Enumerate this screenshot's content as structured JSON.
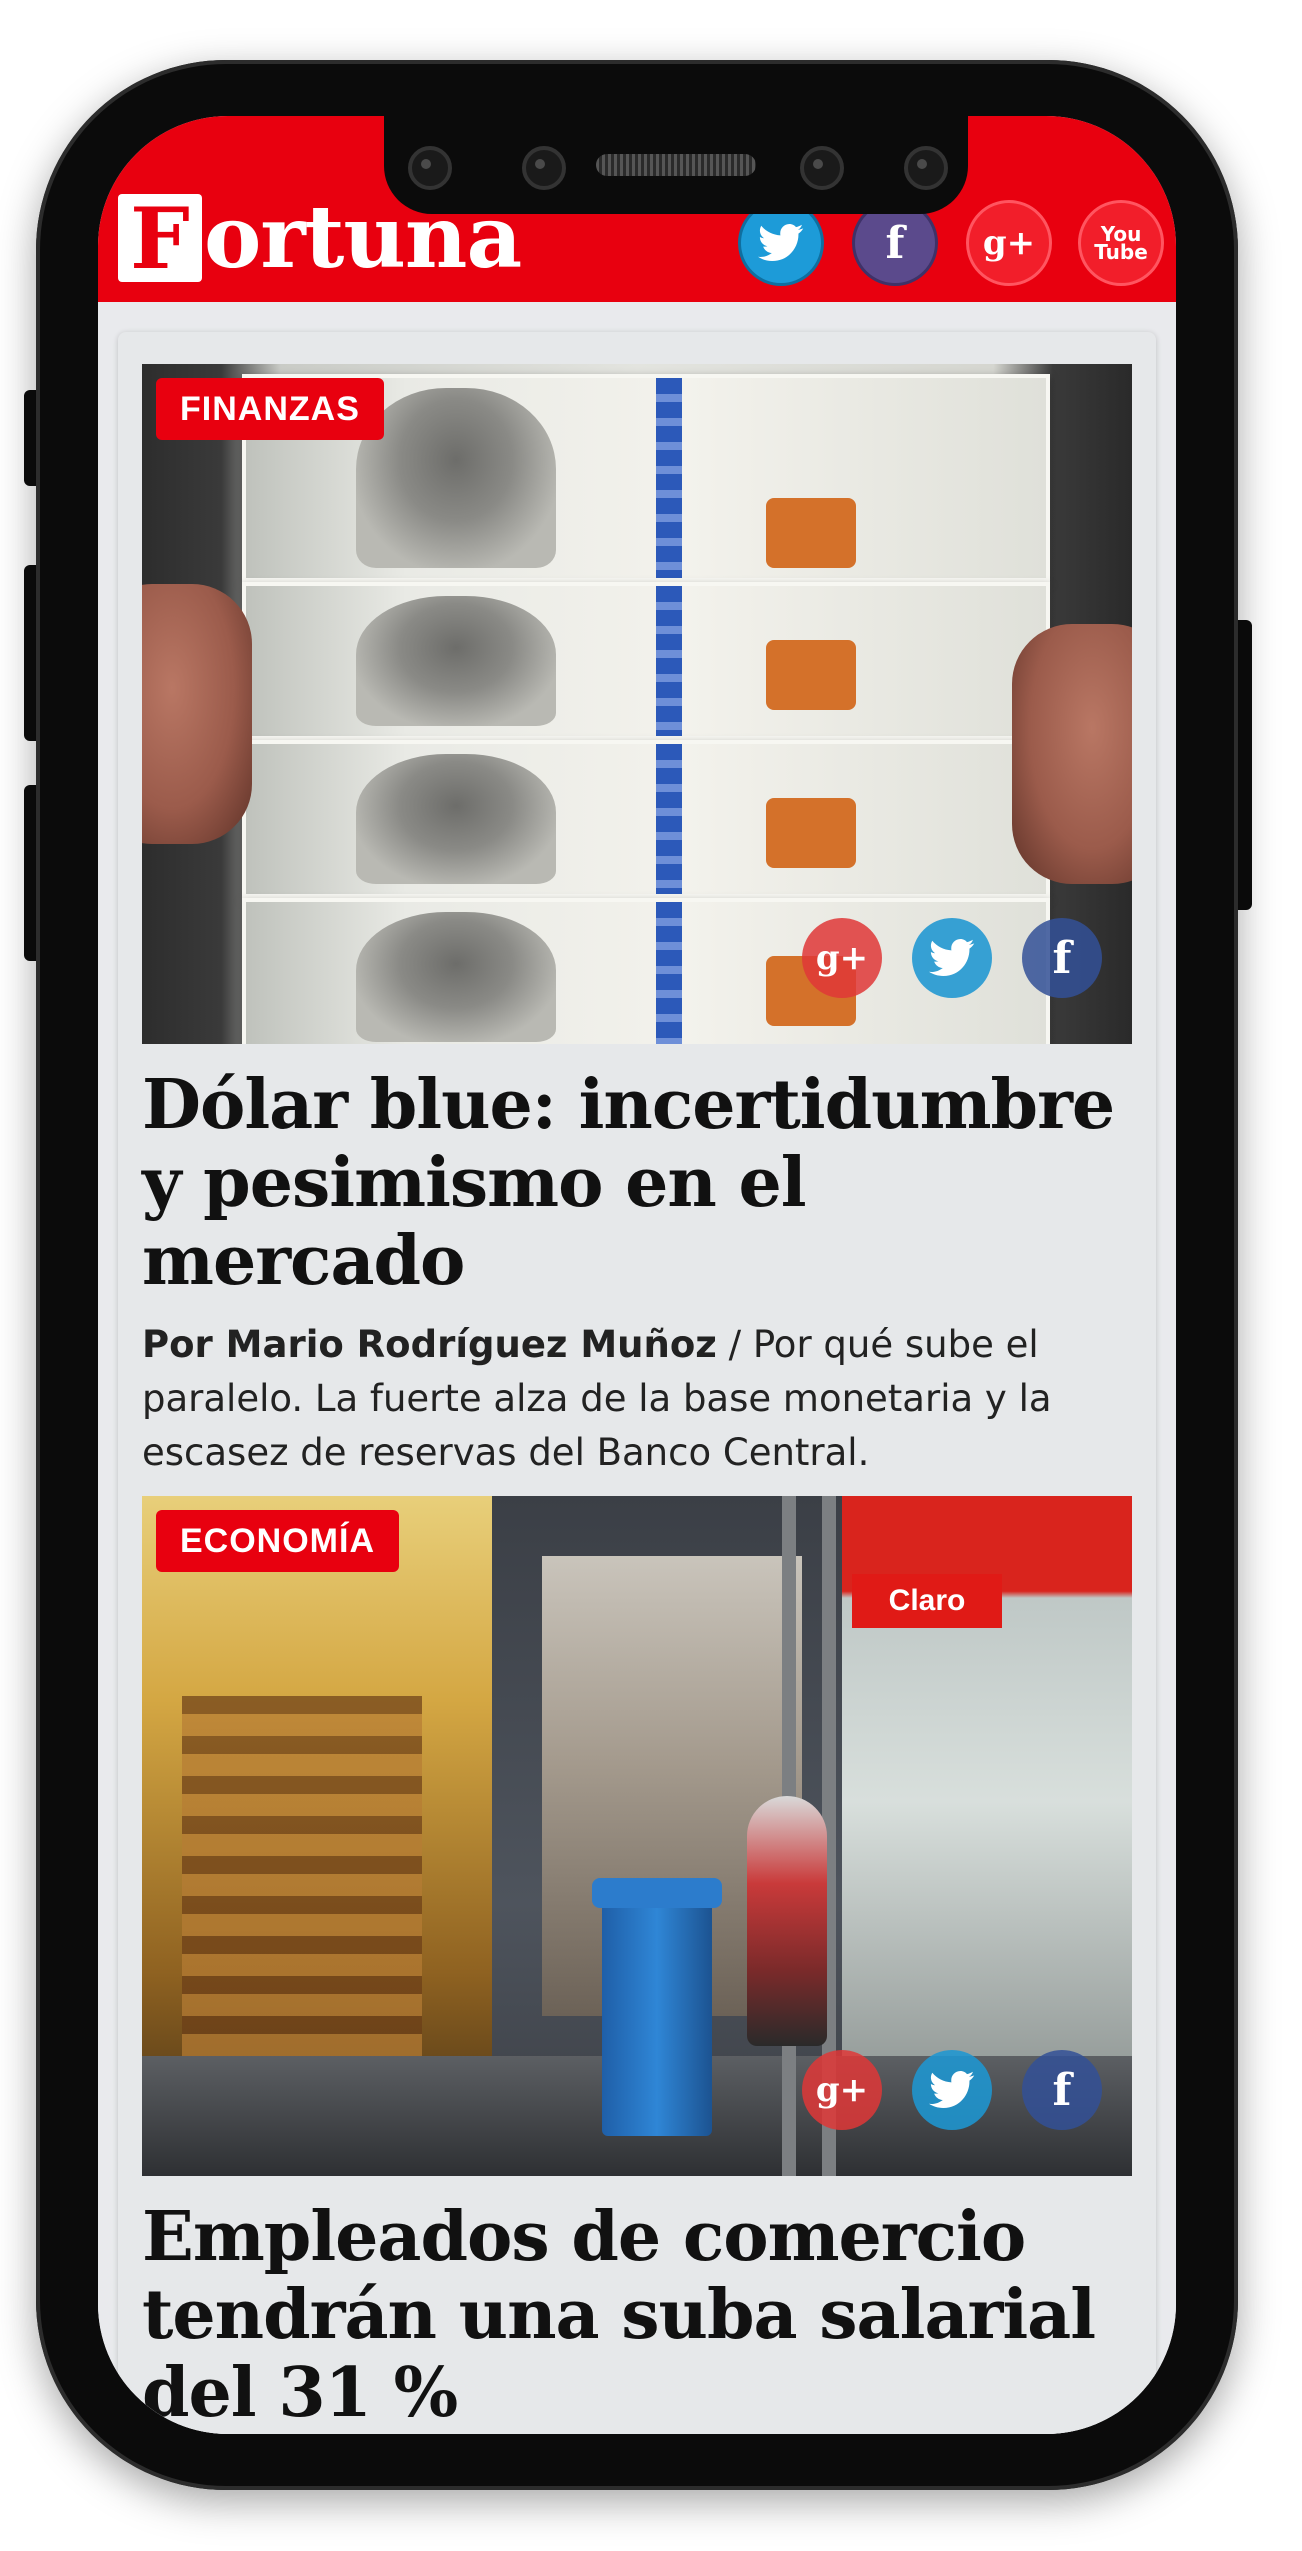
{
  "header": {
    "logo_first_letter": "F",
    "logo_rest": "ortuna",
    "social": {
      "twitter_icon": "twitter-bird-icon",
      "facebook_label": "f",
      "googleplus_label": "g+",
      "youtube_label_top": "You",
      "youtube_label_bottom": "Tube"
    }
  },
  "articles": [
    {
      "category": "FINANZAS",
      "image": "dollar-bills-photo",
      "title": "Dólar blue: incertidumbre y pesimismo en el mercado",
      "author": "Por Mario Rodríguez Muñoz",
      "separator": " / ",
      "summary": "Por qué sube el paralelo. La fuerte alza de la base monetaria y la escasez de reservas del Banco Central.",
      "share": {
        "googleplus_label": "g+",
        "facebook_label": "f"
      }
    },
    {
      "category": "ECONOMÍA",
      "image": "shopping-street-photo",
      "image_sign": "Claro",
      "title": "Empleados de comercio tendrán una suba salarial del 31 %",
      "share": {
        "googleplus_label": "g+",
        "facebook_label": "f"
      }
    }
  ],
  "colors": {
    "brand_red": "#e8000f",
    "twitter_blue": "#1d9bd8",
    "facebook_purple": "#5b4a8c"
  }
}
